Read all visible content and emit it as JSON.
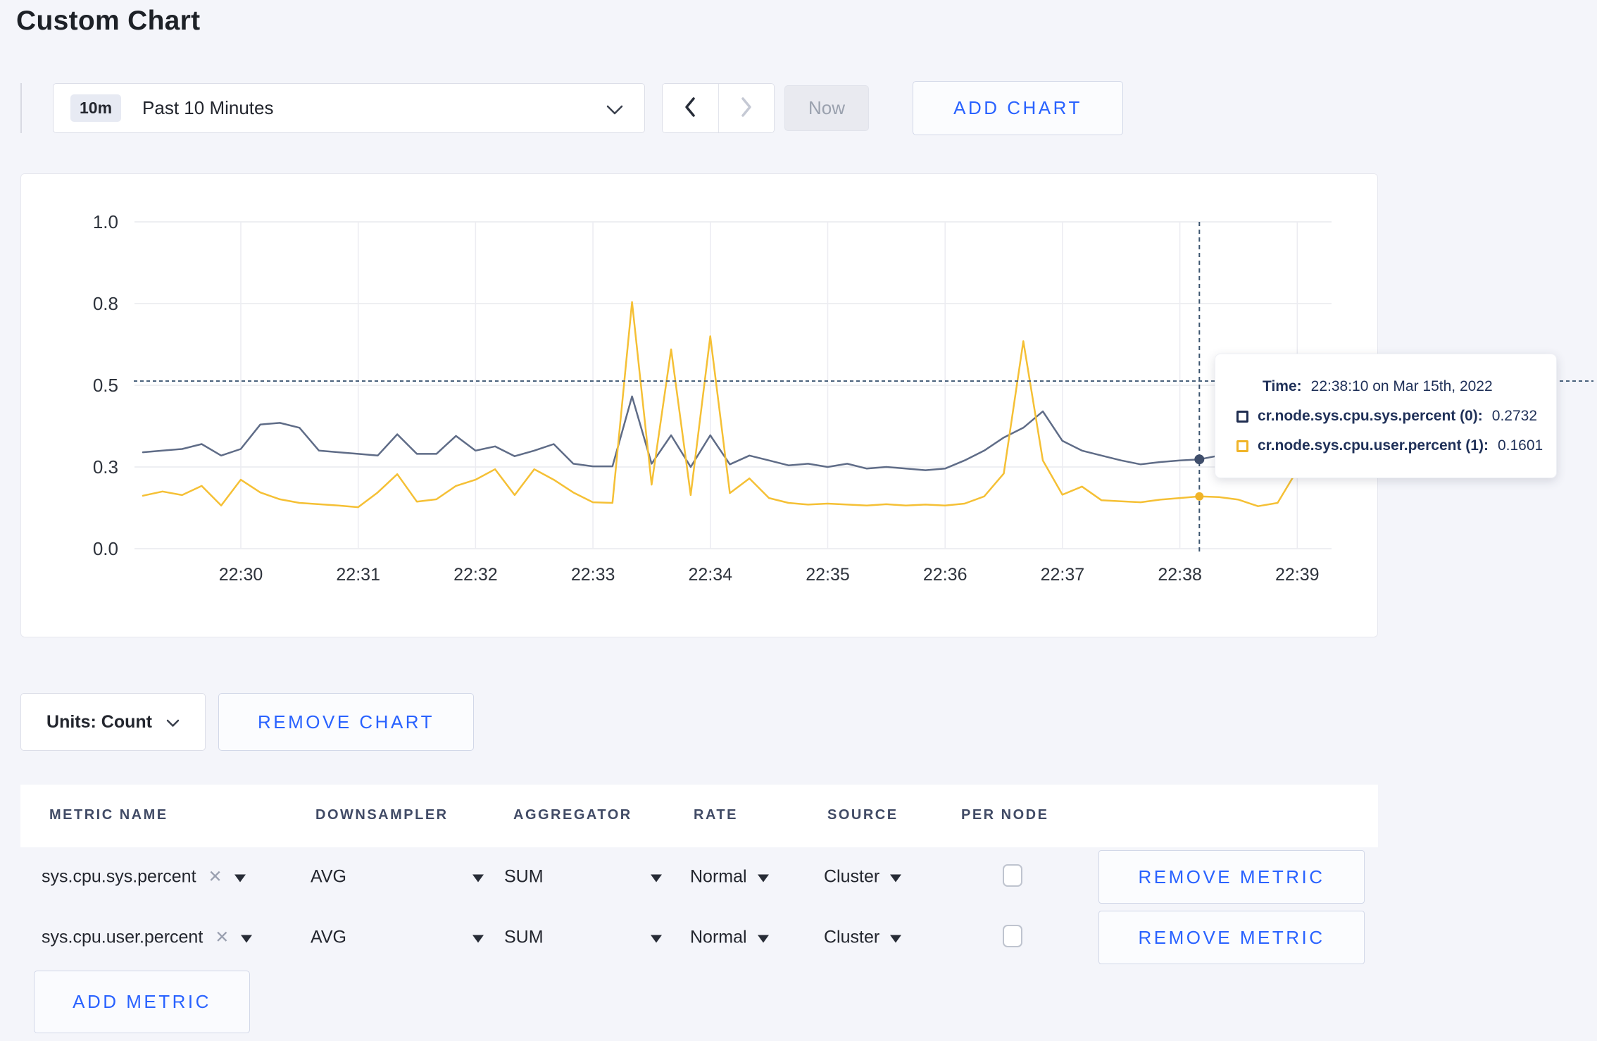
{
  "page": {
    "title": "Custom Chart",
    "colors": {
      "background": "#f4f5fa",
      "accent_blue": "#2962ff",
      "series_sys": "#5f6c87",
      "series_user": "#f5c035",
      "tooltip_text": "#1f3058"
    }
  },
  "toolbar": {
    "timescale_badge": "10m",
    "timescale_label": "Past 10 Minutes",
    "now_label": "Now",
    "add_chart_label": "ADD CHART"
  },
  "icons": {
    "timescale_chevron": "chevron-down",
    "prev": "chevron-left",
    "next": "chevron-right",
    "units_chevron": "chevron-down",
    "metric_remove": "✕",
    "select_caret": "caret-down"
  },
  "chart_data": {
    "type": "line",
    "title": "",
    "xlabel": "",
    "ylabel": "",
    "ylim": [
      0,
      1.0
    ],
    "grid": true,
    "legend_position": "tooltip",
    "y_ticks": {
      "values": [
        0,
        0.25,
        0.5,
        0.75,
        1.0
      ],
      "labels": [
        "0.0",
        "0.3",
        "0.5",
        "0.8",
        "1.0"
      ]
    },
    "x_ticks": [
      "22:30",
      "22:31",
      "22:32",
      "22:33",
      "22:34",
      "22:35",
      "22:36",
      "22:37",
      "22:38",
      "22:39"
    ],
    "x_start": "22:29:10",
    "x_interval_seconds": 10,
    "series": [
      {
        "name": "cr.node.sys.cpu.sys.percent",
        "color": "#5f6c87",
        "values": [
          0.295,
          0.3,
          0.305,
          0.32,
          0.285,
          0.305,
          0.38,
          0.385,
          0.37,
          0.3,
          0.295,
          0.29,
          0.285,
          0.35,
          0.29,
          0.29,
          0.345,
          0.3,
          0.313,
          0.283,
          0.3,
          0.32,
          0.26,
          0.252,
          0.252,
          0.466,
          0.26,
          0.347,
          0.25,
          0.347,
          0.258,
          0.285,
          0.27,
          0.255,
          0.26,
          0.25,
          0.26,
          0.245,
          0.25,
          0.245,
          0.24,
          0.245,
          0.27,
          0.3,
          0.34,
          0.37,
          0.42,
          0.33,
          0.3,
          0.285,
          0.27,
          0.258,
          0.265,
          0.27,
          0.2732,
          0.285,
          0.29,
          0.268,
          0.262,
          0.27,
          0.275
        ]
      },
      {
        "name": "cr.node.sys.cpu.user.percent",
        "color": "#f5c035",
        "values": [
          0.162,
          0.175,
          0.164,
          0.192,
          0.132,
          0.211,
          0.172,
          0.151,
          0.14,
          0.136,
          0.132,
          0.127,
          0.172,
          0.228,
          0.144,
          0.151,
          0.192,
          0.211,
          0.243,
          0.164,
          0.243,
          0.211,
          0.172,
          0.142,
          0.14,
          0.755,
          0.196,
          0.61,
          0.164,
          0.65,
          0.17,
          0.215,
          0.155,
          0.14,
          0.135,
          0.138,
          0.135,
          0.132,
          0.136,
          0.132,
          0.135,
          0.132,
          0.138,
          0.16,
          0.23,
          0.635,
          0.27,
          0.165,
          0.19,
          0.148,
          0.145,
          0.142,
          0.15,
          0.155,
          0.1601,
          0.158,
          0.15,
          0.13,
          0.14,
          0.24,
          0.26
        ]
      }
    ],
    "crosshair": {
      "index": 54,
      "time": "22:38:10",
      "hover_value": 0.51,
      "point_values": [
        0.2732,
        0.1601
      ],
      "point_colors": [
        "#3f4e6b",
        "#f0b429"
      ]
    }
  },
  "tooltip": {
    "time_label": "Time:",
    "time_value": "22:38:10 on Mar 15th, 2022",
    "rows": [
      {
        "name": "cr.node.sys.cpu.sys.percent (0):",
        "value": "0.2732"
      },
      {
        "name": "cr.node.sys.cpu.user.percent (1):",
        "value": "0.1601"
      }
    ]
  },
  "chart_controls": {
    "units_label": "Units: Count",
    "remove_chart_label": "REMOVE CHART"
  },
  "metrics_table": {
    "headers": [
      "METRIC NAME",
      "DOWNSAMPLER",
      "AGGREGATOR",
      "RATE",
      "SOURCE",
      "PER NODE"
    ],
    "rows": [
      {
        "metric": "sys.cpu.sys.percent",
        "downsampler": "AVG",
        "aggregator": "SUM",
        "rate": "Normal",
        "source": "Cluster",
        "per_node": false,
        "remove_label": "REMOVE METRIC"
      },
      {
        "metric": "sys.cpu.user.percent",
        "downsampler": "AVG",
        "aggregator": "SUM",
        "rate": "Normal",
        "source": "Cluster",
        "per_node": false,
        "remove_label": "REMOVE METRIC"
      }
    ],
    "add_metric_label": "ADD METRIC"
  }
}
